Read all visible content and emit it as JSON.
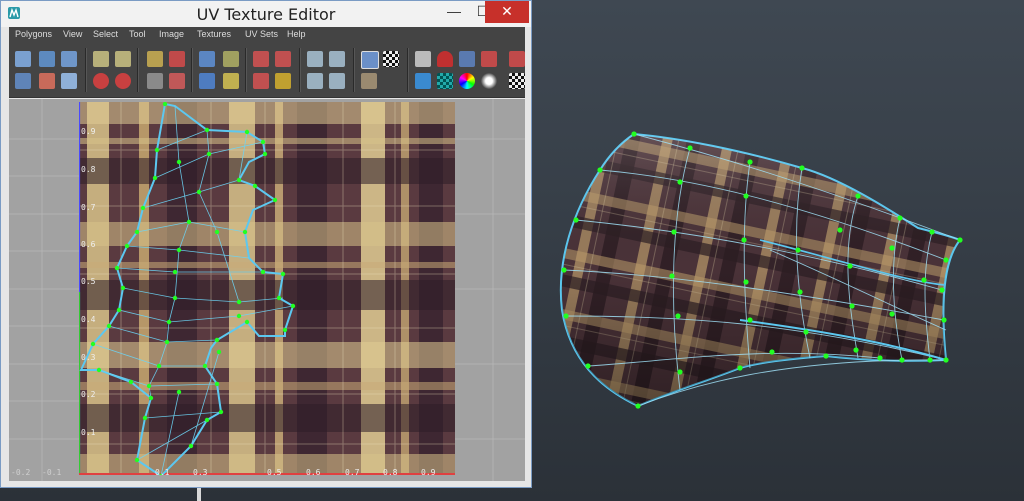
{
  "window": {
    "title": "UV Texture Editor",
    "minimize_glyph": "—",
    "maximize_glyph": "☐",
    "close_glyph": "✕"
  },
  "menubar": {
    "items": [
      "Polygons",
      "View",
      "Select",
      "Tool",
      "Image",
      "Textures",
      "UV Sets",
      "Help"
    ]
  },
  "axis": {
    "u_ticks": [
      "-0.2",
      "-0.1",
      "0.1",
      "0.2",
      "0.3",
      "0.4",
      "0.5",
      "0.6",
      "0.7",
      "0.8",
      "0.9"
    ],
    "v_ticks": [
      "0.9",
      "0.8",
      "0.7",
      "0.6",
      "0.5",
      "0.4",
      "0.3",
      "0.2",
      "0.1",
      "0"
    ]
  },
  "colors": {
    "selection_edge": "#5cc8f0",
    "uv_point": "#22ff22",
    "close_button": "#c7302a"
  },
  "icons": {
    "app": "maya-app-icon",
    "texture": "plaid-fabric-texture",
    "viewport": "3d-sleeve-mesh"
  }
}
